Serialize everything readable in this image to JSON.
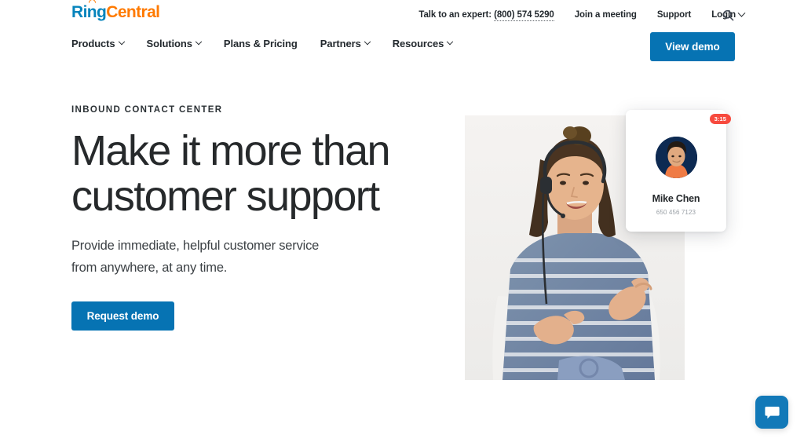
{
  "brand": {
    "logo_ring": "Ring",
    "logo_central": "Central",
    "accent_blue": "#0673b3",
    "accent_orange": "#ff7a00",
    "logo_blue": "#0684bc",
    "badge_red": "#f74a3e"
  },
  "utility_bar": {
    "expert_label": "Talk to an expert:",
    "expert_phone": "(800) 574 5290",
    "join_meeting": "Join a meeting",
    "support": "Support",
    "login": "Login",
    "search_icon": "search-icon"
  },
  "main_nav": {
    "items": [
      {
        "label": "Products",
        "has_chevron": true
      },
      {
        "label": "Solutions",
        "has_chevron": true
      },
      {
        "label": "Plans & Pricing",
        "has_chevron": false
      },
      {
        "label": "Partners",
        "has_chevron": true
      },
      {
        "label": "Resources",
        "has_chevron": true
      }
    ],
    "demo_button": "View demo"
  },
  "hero": {
    "eyebrow": "INBOUND CONTACT CENTER",
    "headline": "Make it more than customer support",
    "subhead": "Provide immediate, helpful customer service from anywhere, at any time.",
    "cta": "Request demo",
    "image_alt": "Customer service agent wearing a headset gesturing while speaking"
  },
  "contact_card": {
    "timer": "3:15",
    "name": "Mike Chen",
    "phone": "650 456 7123",
    "avatar_alt": "Photo of Mike Chen"
  },
  "chat": {
    "icon": "chat-bubble-icon",
    "label": "Chat"
  }
}
